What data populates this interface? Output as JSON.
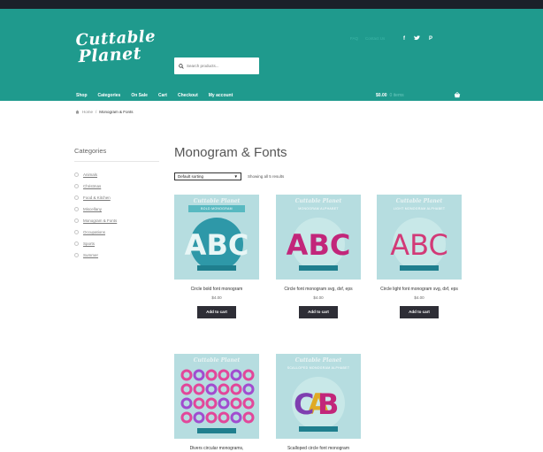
{
  "header": {
    "logo_line1": "Cuttable",
    "logo_line2": "Planet",
    "search_placeholder": "Search products...",
    "toplinks": [
      "FAQ",
      "Contact Us"
    ],
    "social": [
      "f",
      "▾",
      "P"
    ],
    "nav": [
      "Shop",
      "Categories",
      "On Sale",
      "Cart",
      "Checkout",
      "My account"
    ],
    "cart_total": "$0.00",
    "cart_items": "0 items"
  },
  "breadcrumb": {
    "home": "Home",
    "sep": "/",
    "current": "Monogram & Fonts"
  },
  "sidebar": {
    "heading": "Categories",
    "items": [
      "Animals",
      "Christmas",
      "Food & Kitchen",
      "Miscellany",
      "Monogram & Fonts",
      "Occupations",
      "Sports",
      "Summer"
    ]
  },
  "main": {
    "title": "Monogram & Fonts",
    "sort_value": "Default sorting",
    "results_text": "Showing all 5 results",
    "add_to_cart_label": "Add to cart",
    "products": [
      {
        "name": "Circle bold font monogram",
        "price": "$4.00",
        "brand": "Cuttable Planet",
        "subtitle": "BOLD MONOGRAM"
      },
      {
        "name": "Circle font monogram svg, dxf, eps",
        "price": "$4.00",
        "brand": "Cuttable Planet",
        "subtitle": "MONOGRAM ALPHABET"
      },
      {
        "name": "Circle light font monogram svg, dxf, eps",
        "price": "$4.00",
        "brand": "Cuttable Planet",
        "subtitle": "LIGHT MONOGRAM ALPHABET"
      },
      {
        "name": "Divers circular monograms,",
        "price": "",
        "brand": "Cuttable Planet",
        "subtitle": ""
      },
      {
        "name": "Scalloped circle font monogram",
        "price": "",
        "brand": "Cuttable Planet",
        "subtitle": "SCALLOPED MONOGRAM ALPHABET"
      }
    ]
  },
  "colors": {
    "header_bg": "#1f9a8d",
    "top_strip": "#1b2029",
    "button": "#2e2e36",
    "thumb_bg": "#b6dde0"
  }
}
